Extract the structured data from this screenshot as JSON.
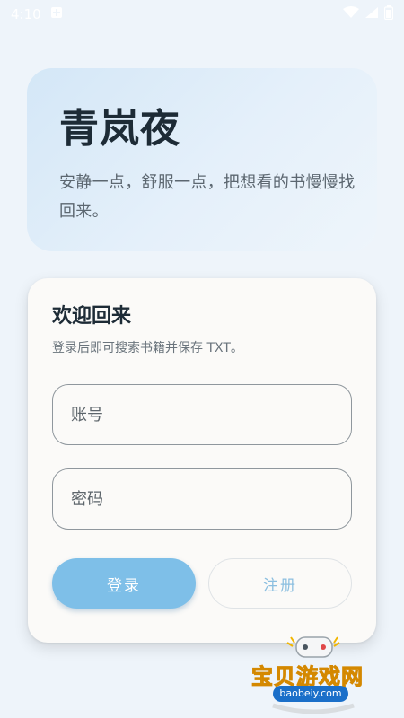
{
  "status_bar": {
    "time": "4:10"
  },
  "hero": {
    "title": "青岚夜",
    "subtitle": "安静一点，舒服一点，把想看的书慢慢找回来。"
  },
  "login_card": {
    "title": "欢迎回来",
    "hint": "登录后即可搜索书籍并保存 TXT。",
    "account_placeholder": "账号",
    "password_placeholder": "密码",
    "login_label": "登录",
    "register_label": "注册"
  },
  "watermark": {
    "text": "宝贝游戏网",
    "url": "baobeiy.com"
  },
  "colors": {
    "accent": "#7ebfe8",
    "register_text": "#8cbfe0",
    "background": "#eef4fa",
    "card": "#fbfaf8"
  }
}
